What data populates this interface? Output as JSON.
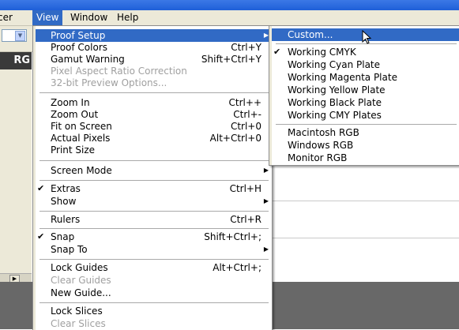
{
  "menubar": {
    "items": [
      {
        "label": "cer"
      },
      {
        "label": "View"
      },
      {
        "label": "Window"
      },
      {
        "label": "Help"
      }
    ],
    "active": "View"
  },
  "panel": {
    "tab_label": "RG"
  },
  "view_menu": {
    "items": [
      {
        "label": "Proof Setup",
        "shortcut": "",
        "submenu": true,
        "highlighted": true
      },
      {
        "label": "Proof Colors",
        "shortcut": "Ctrl+Y"
      },
      {
        "label": "Gamut Warning",
        "shortcut": "Shift+Ctrl+Y"
      },
      {
        "label": "Pixel Aspect Ratio Correction",
        "disabled": true
      },
      {
        "label": "32-bit Preview Options...",
        "disabled": true
      },
      {
        "label": "Zoom In",
        "shortcut": "Ctrl++"
      },
      {
        "label": "Zoom Out",
        "shortcut": "Ctrl+-"
      },
      {
        "label": "Fit on Screen",
        "shortcut": "Ctrl+0"
      },
      {
        "label": "Actual Pixels",
        "shortcut": "Alt+Ctrl+0"
      },
      {
        "label": "Print Size",
        "shortcut": ""
      },
      {
        "label": "Screen Mode",
        "submenu": true
      },
      {
        "label": "Extras",
        "shortcut": "Ctrl+H",
        "checked": true
      },
      {
        "label": "Show",
        "submenu": true
      },
      {
        "label": "Rulers",
        "shortcut": "Ctrl+R"
      },
      {
        "label": "Snap",
        "shortcut": "Shift+Ctrl+;",
        "checked": true
      },
      {
        "label": "Snap To",
        "submenu": true
      },
      {
        "label": "Lock Guides",
        "shortcut": "Alt+Ctrl+;"
      },
      {
        "label": "Clear Guides",
        "disabled": true
      },
      {
        "label": "New Guide..."
      },
      {
        "label": "Lock Slices"
      },
      {
        "label": "Clear Slices",
        "disabled": true
      }
    ]
  },
  "proof_submenu": {
    "items": [
      {
        "label": "Custom...",
        "highlighted": true
      },
      {
        "label": "Working CMYK",
        "checked": true
      },
      {
        "label": "Working Cyan Plate"
      },
      {
        "label": "Working Magenta Plate"
      },
      {
        "label": "Working Yellow Plate"
      },
      {
        "label": "Working Black Plate"
      },
      {
        "label": "Working CMY Plates"
      },
      {
        "label": "Macintosh RGB"
      },
      {
        "label": "Windows RGB"
      },
      {
        "label": "Monitor RGB"
      }
    ]
  },
  "glyphs": {
    "check": "✔",
    "arrow": "▶",
    "scroll_right": "▶",
    "combo_down": "▼"
  },
  "colors": {
    "highlight": "#316ac5",
    "titlebar": "#1f5fd8",
    "menubar": "#ece9d8",
    "workarea": "#686868"
  }
}
